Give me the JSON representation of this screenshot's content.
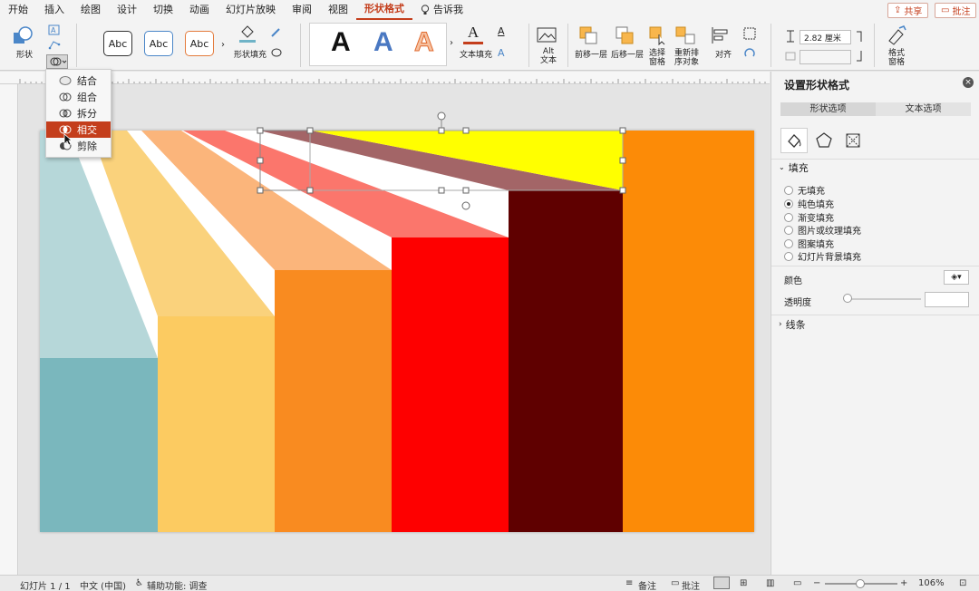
{
  "menu": {
    "tabs": [
      "开始",
      "插入",
      "绘图",
      "设计",
      "切换",
      "动画",
      "幻灯片放映",
      "审阅",
      "视图",
      "形状格式"
    ],
    "active_tab": "形状格式",
    "tell_me": "告诉我",
    "share": "共享",
    "comments": "批注"
  },
  "ribbon": {
    "shape_label": "形状",
    "style_samples": [
      "Abc",
      "Abc",
      "Abc"
    ],
    "shape_fill": "形状填充",
    "wordart_samples": [
      "A",
      "A",
      "A"
    ],
    "text_fill": "文本填充",
    "alt_text_line1": "Alt",
    "alt_text_line2": "文本",
    "bring_forward": "前移一层",
    "send_backward": "后移一层",
    "selection_pane_line1": "选择",
    "selection_pane_line2": "窗格",
    "reorder_line1": "重新排",
    "reorder_line2": "序对象",
    "align": "对齐",
    "height_value": "2.82 厘米",
    "format_pane_line1": "格式",
    "format_pane_line2": "窗格"
  },
  "merge_menu": {
    "items": [
      {
        "label": "结合",
        "icon": "union-icon",
        "selected": false
      },
      {
        "label": "组合",
        "icon": "combine-icon",
        "selected": false
      },
      {
        "label": "拆分",
        "icon": "fragment-icon",
        "selected": false
      },
      {
        "label": "相交",
        "icon": "intersect-icon",
        "selected": true
      },
      {
        "label": "剪除",
        "icon": "subtract-icon",
        "selected": false
      }
    ]
  },
  "pane": {
    "title": "设置形状格式",
    "tabs": [
      "形状选项",
      "文本选项"
    ],
    "fill_section": "填充",
    "fill_options": [
      {
        "label": "无填充",
        "on": false
      },
      {
        "label": "纯色填充",
        "on": true
      },
      {
        "label": "渐变填充",
        "on": false
      },
      {
        "label": "图片或纹理填充",
        "on": false
      },
      {
        "label": "图案填充",
        "on": false
      },
      {
        "label": "幻灯片背景填充",
        "on": false
      }
    ],
    "color_label": "颜色",
    "transparency_label": "透明度",
    "line_section": "线条"
  },
  "status": {
    "slide": "幻灯片 1 / 1",
    "language": "中文 (中国)",
    "accessibility": "辅助功能: 调查",
    "notes": "备注",
    "comments": "批注",
    "zoom": "106%"
  },
  "colors": {
    "accent": "#c43e1c",
    "teal": "#7ab7bd",
    "light_teal": "#b6d7d9",
    "yellow_light": "#fad27c",
    "peach": "#fbb57b",
    "orange": "#f98b20",
    "salmon": "#fb766c",
    "red": "#fe0000",
    "maroon": "#5f0000",
    "dark_orange": "#fc8b07",
    "mauve": "#a36567",
    "bright_yellow": "#ffff00"
  }
}
